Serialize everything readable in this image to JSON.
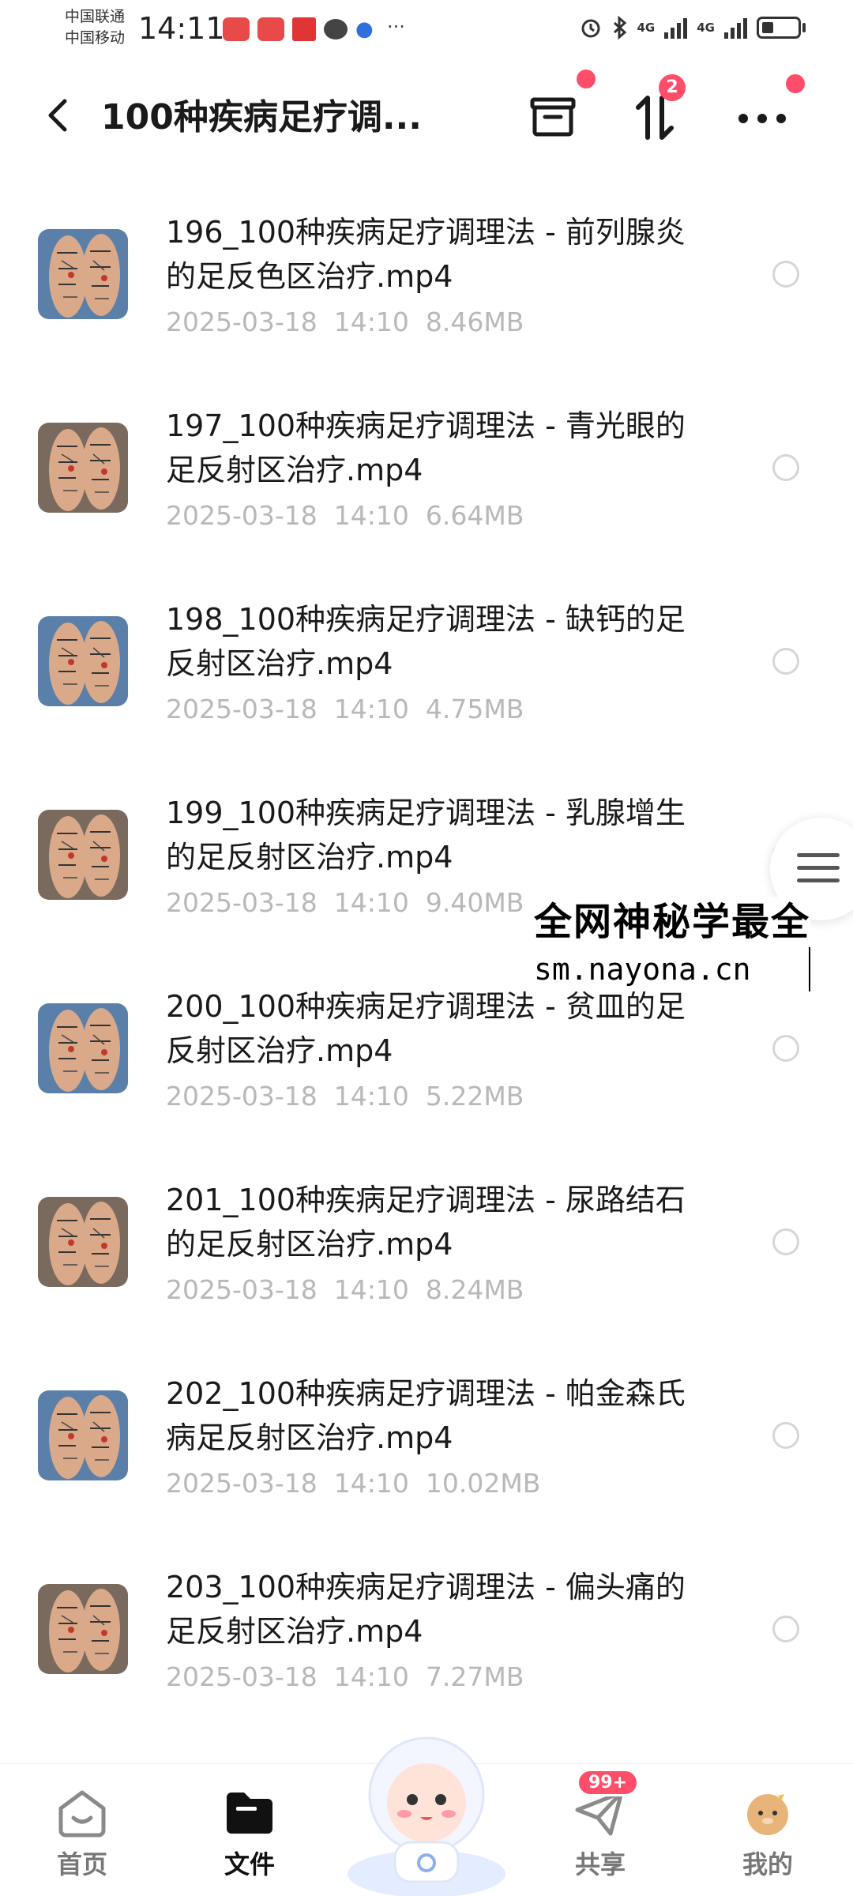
{
  "status_bar": {
    "carrier_1": "中国联通",
    "carrier_2": "中国移动",
    "time": "14:11",
    "network_1": "4G",
    "network_2": "4G"
  },
  "header": {
    "title": "100种疾病足疗调...",
    "sort_badge": "2"
  },
  "files": [
    {
      "name": "196_100种疾病足疗调理法 - 前列腺炎的足反色区治疗.mp4",
      "date": "2025-03-18",
      "time": "14:10",
      "size": "8.46MB"
    },
    {
      "name": "197_100种疾病足疗调理法 - 青光眼的足反射区治疗.mp4",
      "date": "2025-03-18",
      "time": "14:10",
      "size": "6.64MB"
    },
    {
      "name": "198_100种疾病足疗调理法 - 缺钙的足反射区治疗.mp4",
      "date": "2025-03-18",
      "time": "14:10",
      "size": "4.75MB"
    },
    {
      "name": "199_100种疾病足疗调理法 - 乳腺增生的足反射区治疗.mp4",
      "date": "2025-03-18",
      "time": "14:10",
      "size": "9.40MB"
    },
    {
      "name": "200_100种疾病足疗调理法 - 贫皿的足反射区治疗.mp4",
      "date": "2025-03-18",
      "time": "14:10",
      "size": "5.22MB"
    },
    {
      "name": "201_100种疾病足疗调理法 - 尿路结石的足反射区治疗.mp4",
      "date": "2025-03-18",
      "time": "14:10",
      "size": "8.24MB"
    },
    {
      "name": "202_100种疾病足疗调理法 - 帕金森氏病足反射区治疗.mp4",
      "date": "2025-03-18",
      "time": "14:10",
      "size": "10.02MB"
    },
    {
      "name": "203_100种疾病足疗调理法 - 偏头痛的足反射区治疗.mp4",
      "date": "2025-03-18",
      "time": "14:10",
      "size": "7.27MB"
    }
  ],
  "watermark": {
    "line1": "全网神秘学最全",
    "line2": "sm.nayona.cn"
  },
  "bottom_nav": {
    "home": "首页",
    "files": "文件",
    "share": "共享",
    "share_badge": "99+",
    "mine": "我的"
  },
  "colors": {
    "accent_red": "#ff4d6a",
    "meta_gray": "#b8b8b8",
    "skin": "#d9a98a"
  }
}
